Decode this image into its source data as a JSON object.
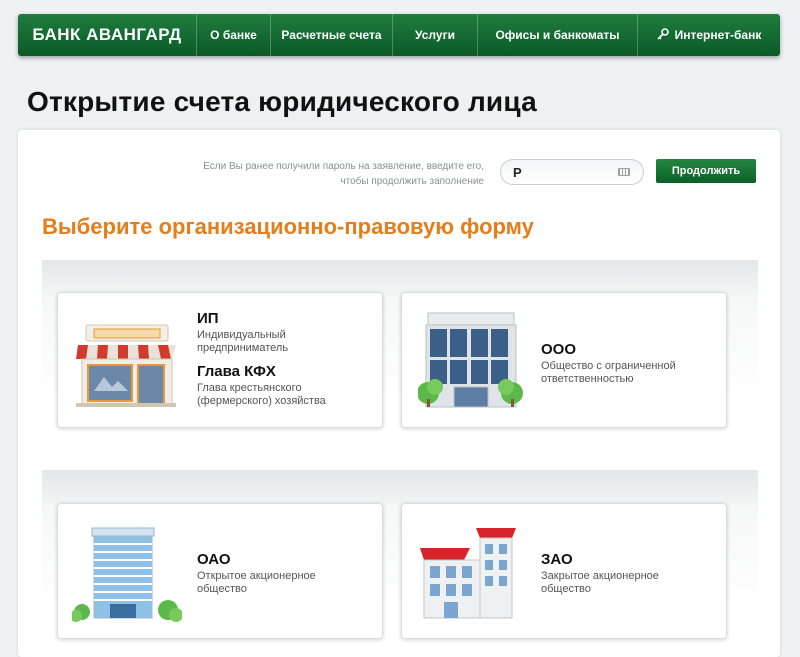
{
  "nav": {
    "logo": "БАНК АВАНГАРД",
    "items": [
      "О банке",
      "Расчетные счета",
      "Услуги",
      "Офисы и банкоматы"
    ],
    "internet_bank": "Интернет-банк",
    "internet_bank_icon": "key-icon"
  },
  "page_title": "Открытие счета юридического лица",
  "password": {
    "hint_line1": "Если Вы ранее получили пароль на заявление, введите его,",
    "hint_line2": "чтобы продолжить заполнение",
    "value": "Р",
    "keyboard_icon": "keyboard-icon",
    "continue_label": "Продолжить"
  },
  "section_title": "Выберите организационно-правовую форму",
  "forms": [
    {
      "title": "ИП",
      "desc": "Индивидуальный предприниматель",
      "title2": "Глава КФХ",
      "desc2": "Глава крестьянского (фермерского) хозяйства",
      "icon": "shop-icon"
    },
    {
      "title": "ООО",
      "desc": "Общество с ограниченной ответственностью",
      "icon": "office-building-icon"
    },
    {
      "title": "ОАО",
      "desc": "Открытое акционерное общество",
      "icon": "skyscraper-icon"
    },
    {
      "title": "ЗАО",
      "desc": "Закрытое акционерное общество",
      "icon": "house-building-icon"
    }
  ],
  "colors": {
    "brand_green": "#0f6a2e",
    "accent_orange": "#e57d1a"
  }
}
